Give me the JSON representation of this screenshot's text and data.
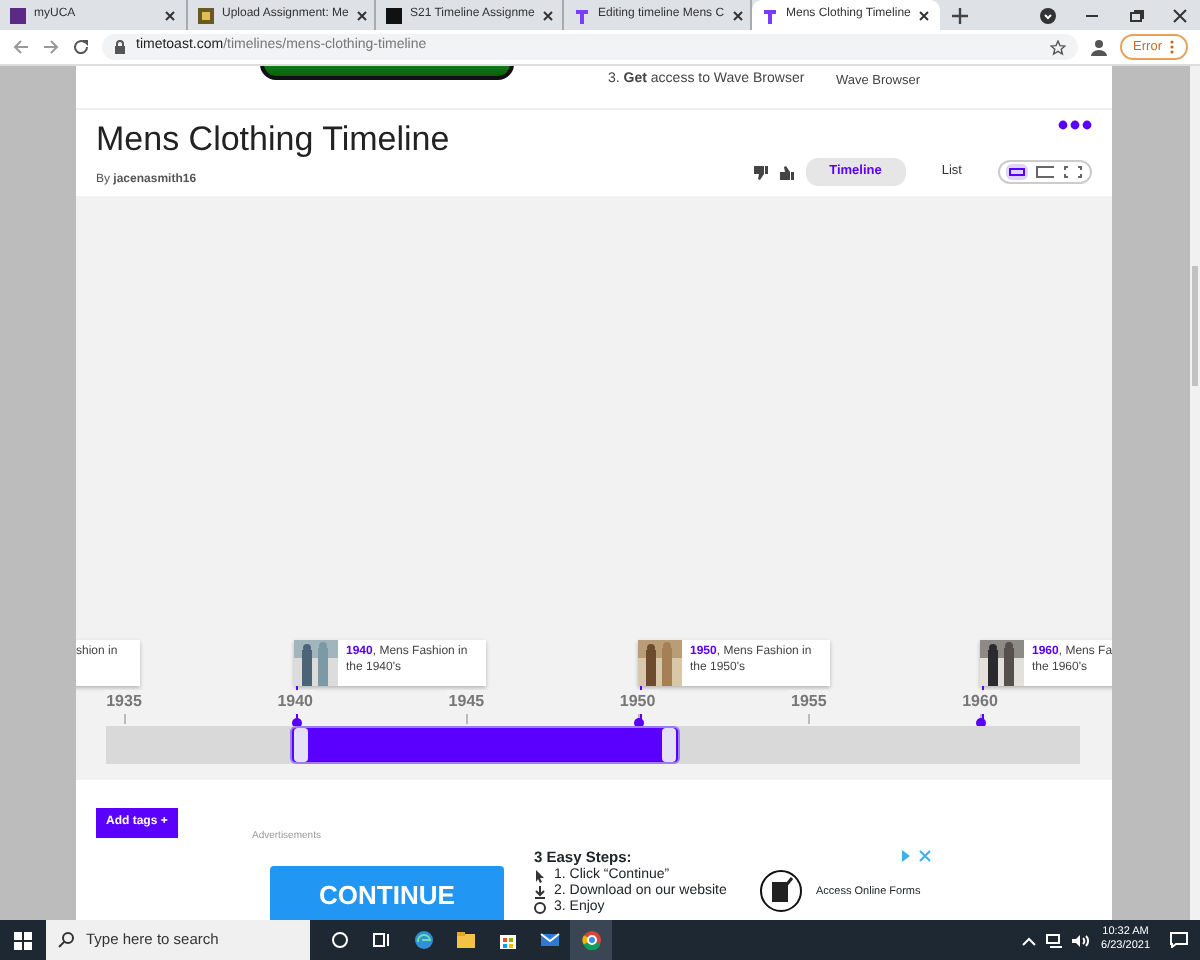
{
  "browser": {
    "tabs": [
      {
        "label": "myUCA",
        "selected": false
      },
      {
        "label": "Upload Assignment: Me",
        "selected": false
      },
      {
        "label": "S21 Timeline Assignme",
        "selected": false
      },
      {
        "label": "Editing timeline Mens C",
        "selected": false
      },
      {
        "label": "Mens Clothing Timeline",
        "selected": true
      }
    ],
    "url_host": "timetoast.com",
    "url_path": "/timelines/mens-clothing-timeline",
    "error_button": "Error"
  },
  "top_ad": {
    "step": "3. **Get** access to Wave Browser",
    "label": "Wave Browser"
  },
  "header": {
    "title": "Mens Clothing Timeline",
    "byline": "By **jacenasmith16**",
    "views": [
      {
        "label": "Timeline",
        "selected": true
      },
      {
        "label": "List",
        "selected": false
      }
    ],
    "layouts": [
      {
        "selected": true
      },
      {
        "selected": false
      },
      {
        "selected": false
      }
    ]
  },
  "timeline": {
    "events": [
      {
        "text": "shion in"
      },
      {
        "text": "**1940**, Mens Fashion in",
        "second": "the 1940's"
      },
      {
        "text": "**1950**, Mens Fashion in",
        "second": "the 1950's"
      },
      {
        "text": "**1960**, Mens Fa",
        "second": "the 1960's"
      }
    ],
    "ticks": [
      "1935",
      "1940",
      "1945",
      "1950",
      "1955",
      "1960"
    ],
    "selection": {
      "level": 0.4
    }
  },
  "add_tags": "Add tags +",
  "ads": {
    "heading": "Advertisements",
    "button": "CONTINUE",
    "steps_title": "3 Easy Steps:",
    "steps": [
      "1. Click “Continue”",
      "2. Download on our website",
      "3. Enjoy"
    ],
    "side": "Access Online Forms"
  },
  "taskbar": {
    "search_placeholder": "Type here to search",
    "time": "10:32 AM",
    "date": "6/23/2021"
  }
}
